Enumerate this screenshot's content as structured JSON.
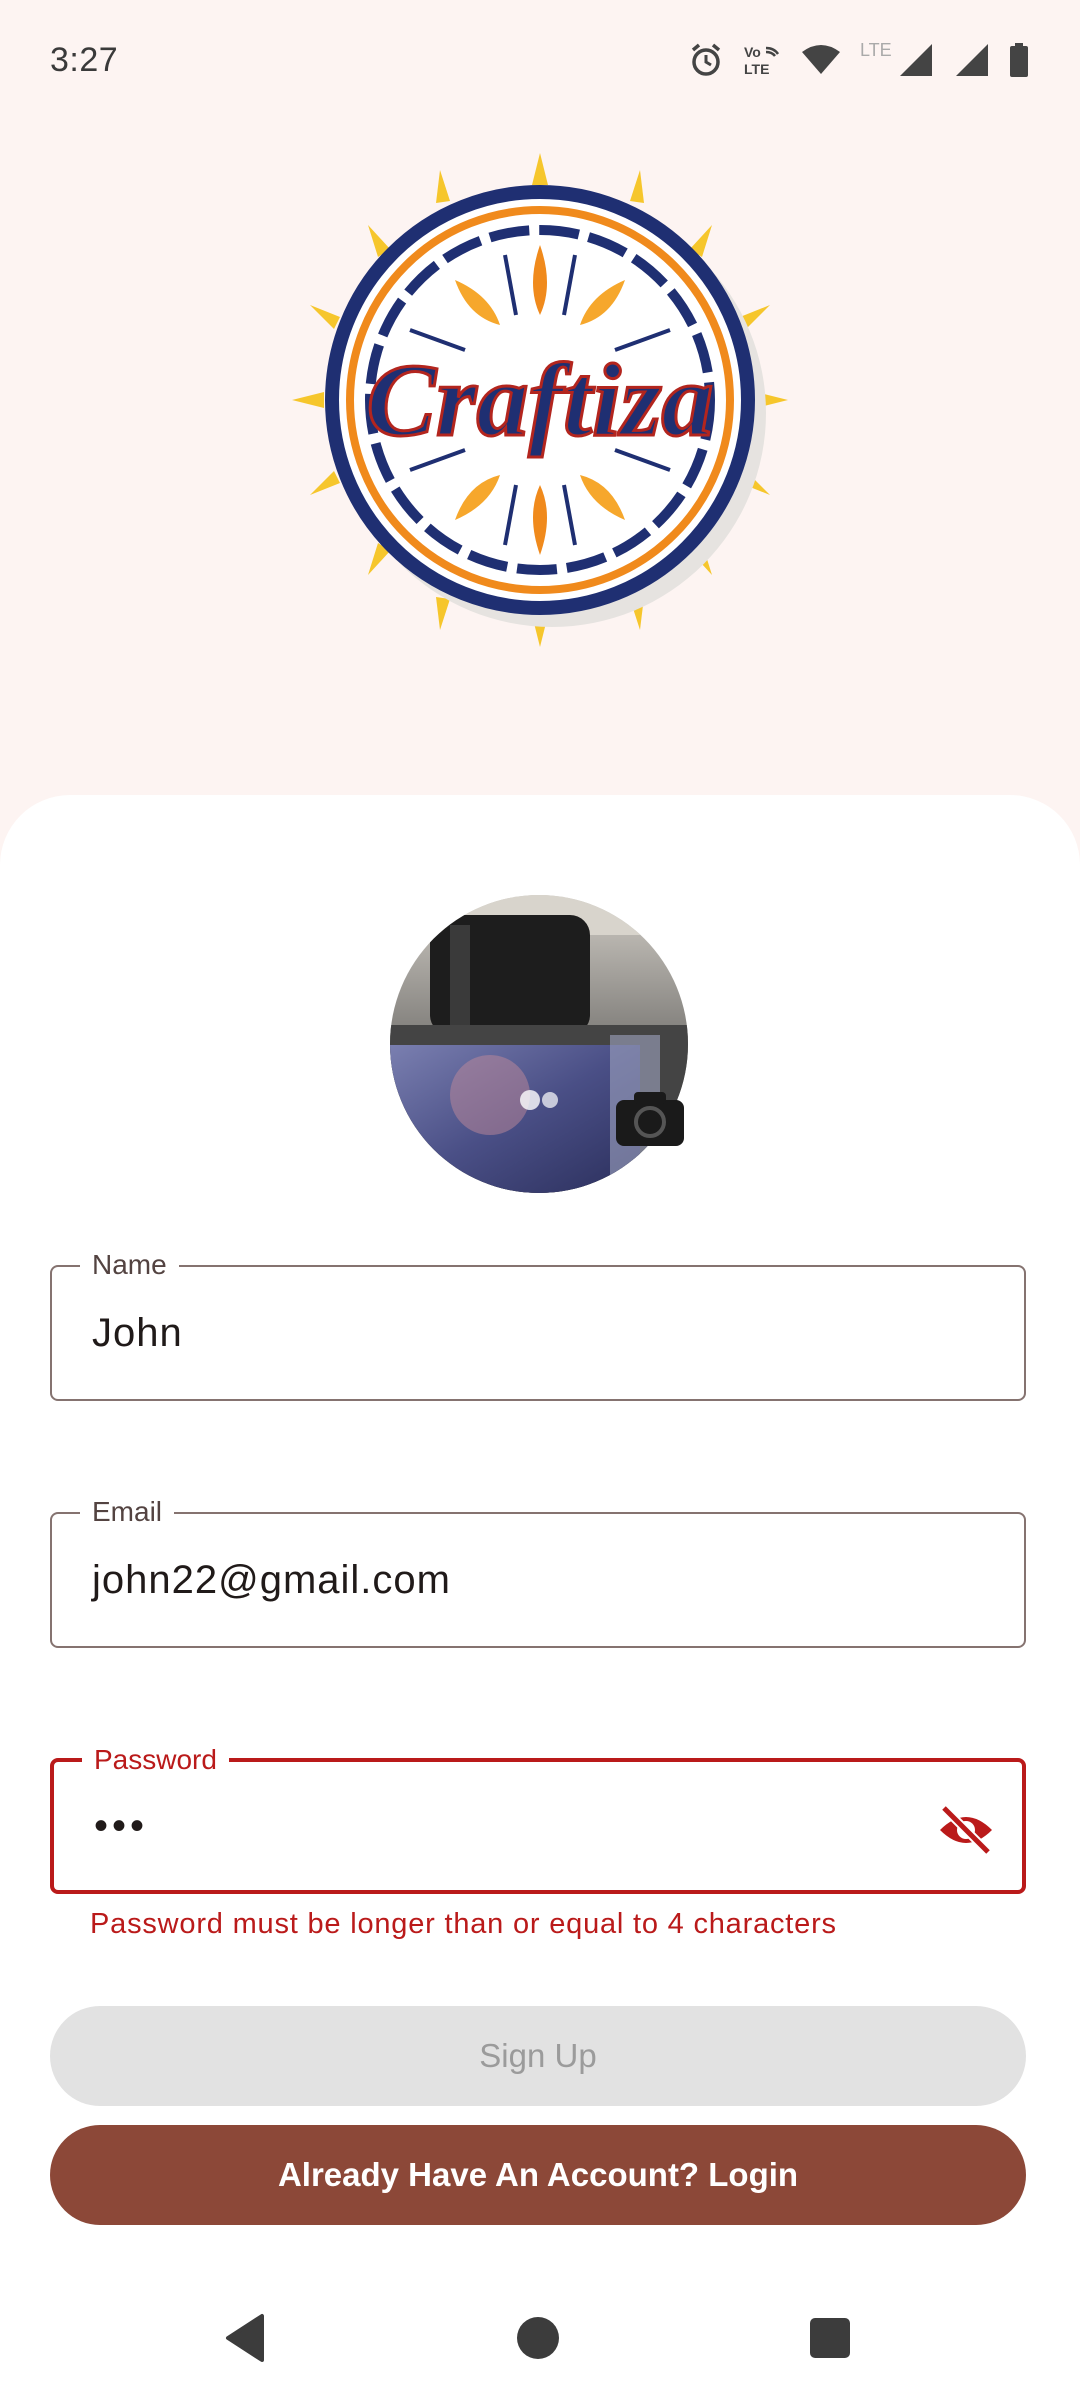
{
  "status_bar": {
    "time": "3:27",
    "icons": [
      "alarm-icon",
      "volte-icon",
      "wifi-icon",
      "lte-icon",
      "signal-icon",
      "signal-icon",
      "battery-icon"
    ],
    "volte_text_top": "Vo",
    "volte_text_bottom": "LTE",
    "lte_text": "LTE"
  },
  "logo": {
    "text": "Craftiza"
  },
  "form": {
    "name": {
      "label": "Name",
      "value": "John"
    },
    "email": {
      "label": "Email",
      "value": "john22@gmail.com"
    },
    "password": {
      "label": "Password",
      "value": "•••",
      "error": "Password must be longer than or equal to 4 characters"
    }
  },
  "buttons": {
    "signup": "Sign Up",
    "login": "Already Have An Account? Login"
  },
  "colors": {
    "accent": "#8c4838",
    "error": "#ba1a1a",
    "background": "#fdf4f2",
    "logo_navy": "#1f2f72",
    "logo_orange": "#f08a1c",
    "logo_yellow": "#f6c62c"
  }
}
